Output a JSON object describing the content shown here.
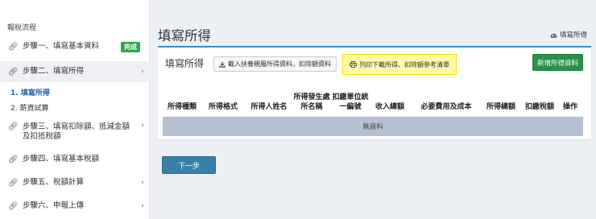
{
  "sidebar": {
    "heading": "報稅流程",
    "steps": [
      {
        "label": "步驟一、填寫基本資料",
        "badge": "完成",
        "icon": "link-icon"
      },
      {
        "label": "步驟二、填寫所得",
        "chevron": "‹",
        "icon": "link-icon"
      },
      {
        "label": "步驟三、填寫扣除額、抵減金額及扣抵稅額",
        "chevron": "‹",
        "icon": "link-icon"
      },
      {
        "label": "步驟四、填寫基本稅額",
        "icon": "link-icon"
      },
      {
        "label": "步驟五、稅額計算",
        "chevron": "‹",
        "icon": "link-icon"
      },
      {
        "label": "步驟六、申報上傳",
        "chevron": "‹",
        "icon": "link-icon"
      }
    ],
    "sub_items": [
      "1. 填寫所得",
      "2. 薪資試算"
    ]
  },
  "page": {
    "title": "填寫所得",
    "breadcrumb": "填寫所得",
    "breadcrumb_icon": "dashboard-icon"
  },
  "card": {
    "title": "填寫所得",
    "import_label": "載入扶養親屬所得資料、扣除額資料",
    "print_label": "列印下載所得、扣除額參考清單",
    "add_label": "新增所得資料"
  },
  "table": {
    "headers": [
      "所得種類",
      "所得格式",
      "所得人姓名",
      "所得發生處所名稱",
      "扣繳單位統一編號",
      "收入總額",
      "必要費用及成本",
      "所得總額",
      "扣繳稅額",
      "操作"
    ],
    "empty_text": "無資料"
  },
  "next_button": "下一步",
  "colors": {
    "accent": "#3c8dbc",
    "success": "#2a9148",
    "highlight": "#fff9a8",
    "active_link": "#1f5fa8"
  }
}
